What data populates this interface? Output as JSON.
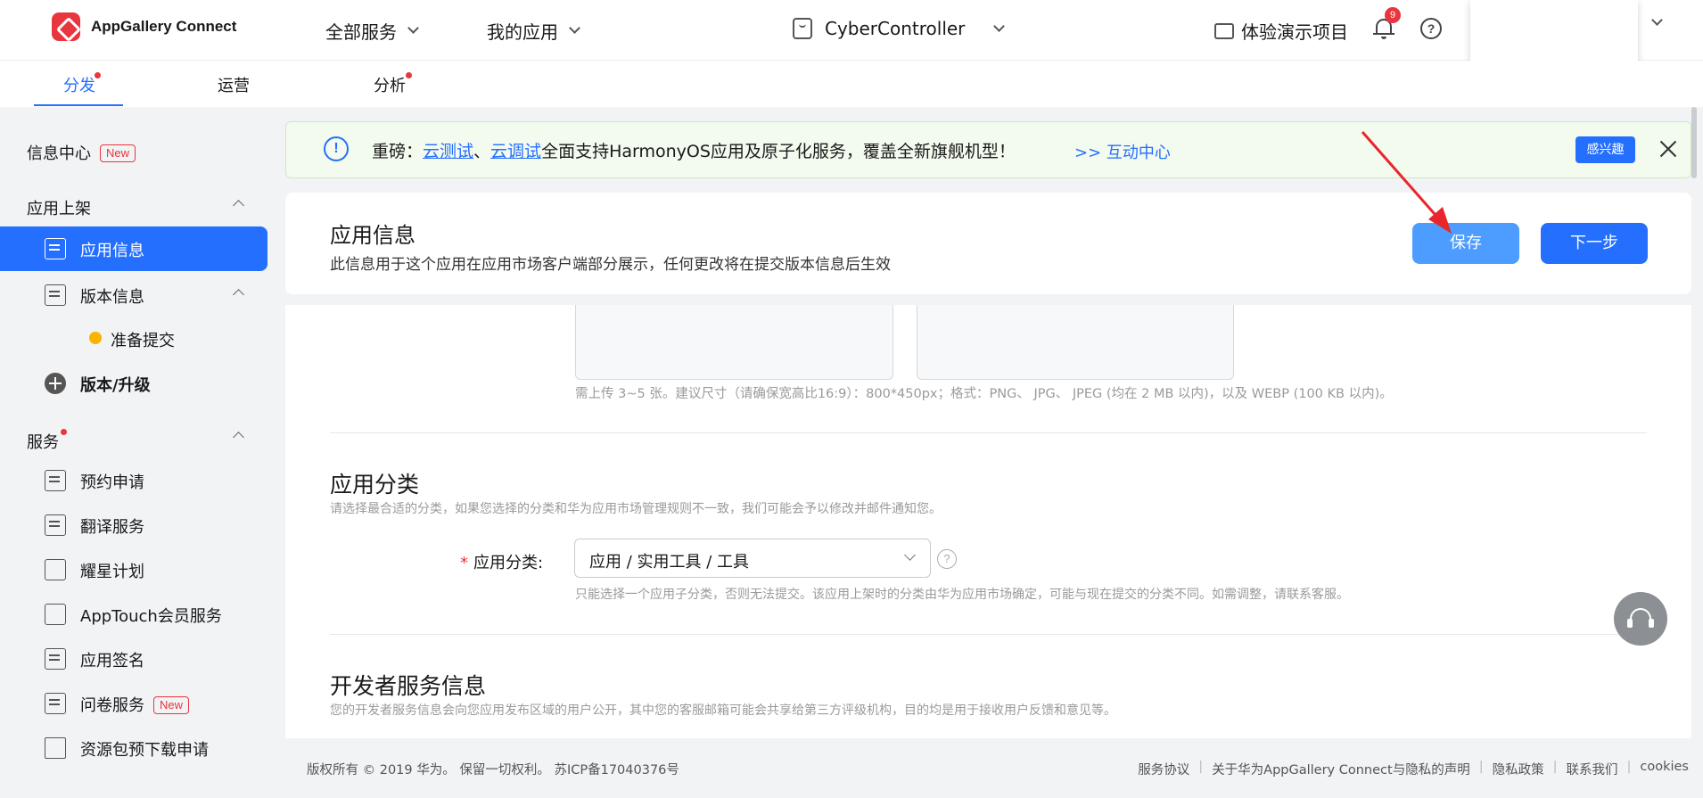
{
  "header": {
    "logo_text": "AppGallery Connect",
    "all_services": "全部服务",
    "my_apps": "我的应用",
    "app_name": "CyberController",
    "demo_project": "体验演示项目",
    "notification_count": "9",
    "help_symbol": "?"
  },
  "tabs": [
    {
      "label": "分发",
      "active": true,
      "has_dot": true
    },
    {
      "label": "运营",
      "active": false,
      "has_dot": false
    },
    {
      "label": "分析",
      "active": false,
      "has_dot": true
    }
  ],
  "sidebar": {
    "info_center": "信息中心",
    "new_badge": "New",
    "group_app_listing": "应用上架",
    "app_info": "应用信息",
    "version_info": "版本信息",
    "ready_submit": "准备提交",
    "version_upgrade": "版本/升级",
    "group_services": "服务",
    "items": [
      {
        "label": "预约申请"
      },
      {
        "label": "翻译服务"
      },
      {
        "label": "耀星计划"
      },
      {
        "label": "AppTouch会员服务"
      },
      {
        "label": "应用签名"
      },
      {
        "label": "问卷服务",
        "badge": "New"
      },
      {
        "label": "资源包预下载申请"
      }
    ]
  },
  "banner": {
    "info_symbol": "!",
    "prefix": "重磅：",
    "link1": "云测试",
    "sep": "、",
    "link2": "云调试",
    "text": "全面支持HarmonyOS应用及原子化服务，覆盖全新旗舰机型！",
    "interactive_center": ">> 互动中心",
    "interest_button": "感兴趣"
  },
  "page": {
    "title": "应用信息",
    "description": "此信息用于这个应用在应用市场客户端部分展示，任何更改将在提交版本信息后生效",
    "save_button": "保存",
    "next_button": "下一步"
  },
  "content": {
    "screenshot_hint": "需上传 3~5 张。建议尺寸（请确保宽高比16:9）：800*450px；格式：PNG、 JPG、 JPEG (均在 2 MB 以内)，以及 WEBP (100 KB 以内)。",
    "category_title": "应用分类",
    "category_desc": "请选择最合适的分类，如果您选择的分类和华为应用市场管理规则不一致，我们可能会予以修改并邮件通知您。",
    "category_required": "*",
    "category_label": "应用分类:",
    "category_value": "应用 / 实用工具 / 工具",
    "category_help_symbol": "?",
    "category_hint": "只能选择一个应用子分类，否则无法提交。该应用上架时的分类由华为应用市场确定，可能与现在提交的分类不同。如需调整，请联系客服。",
    "developer_title": "开发者服务信息",
    "developer_desc": "您的开发者服务信息会向您应用发布区域的用户公开，其中您的客服邮箱可能会共享给第三方评级机构，目的均是用于接收用户反馈和意见等。"
  },
  "footer": {
    "copyright": "版权所有 © 2019 华为。 保留一切权利。 苏ICP备17040376号",
    "service_agreement": "服务协议",
    "privacy_statement": "关于华为AppGallery Connect与隐私的声明",
    "privacy_policy": "隐私政策",
    "contact_us": "联系我们",
    "cookies": "cookies",
    "separator": "|"
  },
  "colors": {
    "accent": "#256fff",
    "save_button": "#4d9cff",
    "brand_red": "#e8353e",
    "annotation_arrow": "#e8262b"
  }
}
